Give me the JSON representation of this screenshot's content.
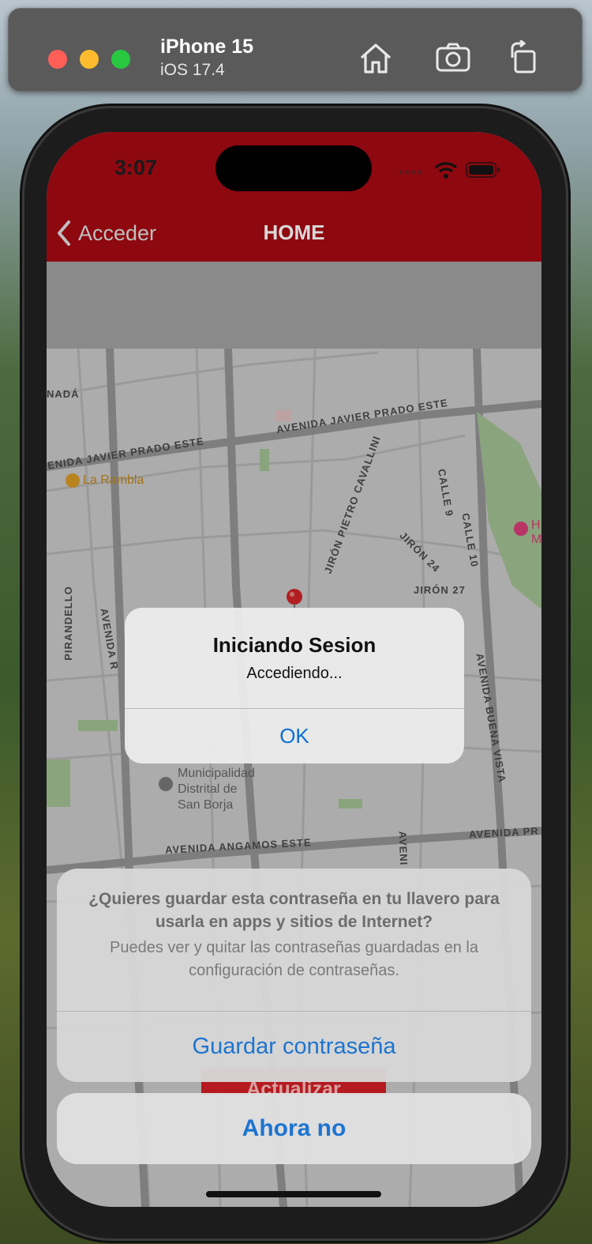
{
  "simulator": {
    "device": "iPhone 15",
    "os": "iOS 17.4",
    "icons": [
      "home-icon",
      "screenshot-icon",
      "rotate-icon"
    ]
  },
  "status_bar": {
    "time": "3:07",
    "icons": [
      "signal-icon",
      "wifi-icon",
      "battery-icon"
    ]
  },
  "nav": {
    "back_label": "Acceder",
    "title": "HOME"
  },
  "map": {
    "streets": [
      "AVENIDA JAVIER PRADO ESTE",
      "ENIDA JAVIER PRADO ESTE",
      "JIRÓN PIETRO CAVALLINI",
      "JIRÓN 24",
      "JIRÓN 27",
      "CALLE 9",
      "CALLE 10",
      "PIRANDELLO",
      "AVENIDA BUENA VISTA",
      "AVENIDA ANGAMOS ESTE",
      "AVENIDA PR",
      "AVENIDA R",
      "AVENI",
      "NADÁ"
    ],
    "pois": {
      "rambla": "La Rambla",
      "municipalidad_1": "Municipalidad",
      "municipalidad_2": "Distrital de",
      "municipalidad_3": "San Borja",
      "hipodromo_1": "H",
      "hipodromo_2": "M"
    }
  },
  "alert": {
    "title": "Iniciando Sesion",
    "message": "Accediendo...",
    "ok_label": "OK"
  },
  "background_button": "Actualizar",
  "password_sheet": {
    "question": "¿Quieres guardar esta contraseña en tu llavero para usarla en apps y sitios de Internet?",
    "info": "Puedes ver y quitar las contraseñas guardadas en la configuración de contraseñas.",
    "save_label": "Guardar contraseña",
    "cancel_label": "Ahora no"
  },
  "colors": {
    "nav_red": "#8e0810",
    "ios_blue": "#0a6fd8",
    "button_red": "#b41a20"
  }
}
